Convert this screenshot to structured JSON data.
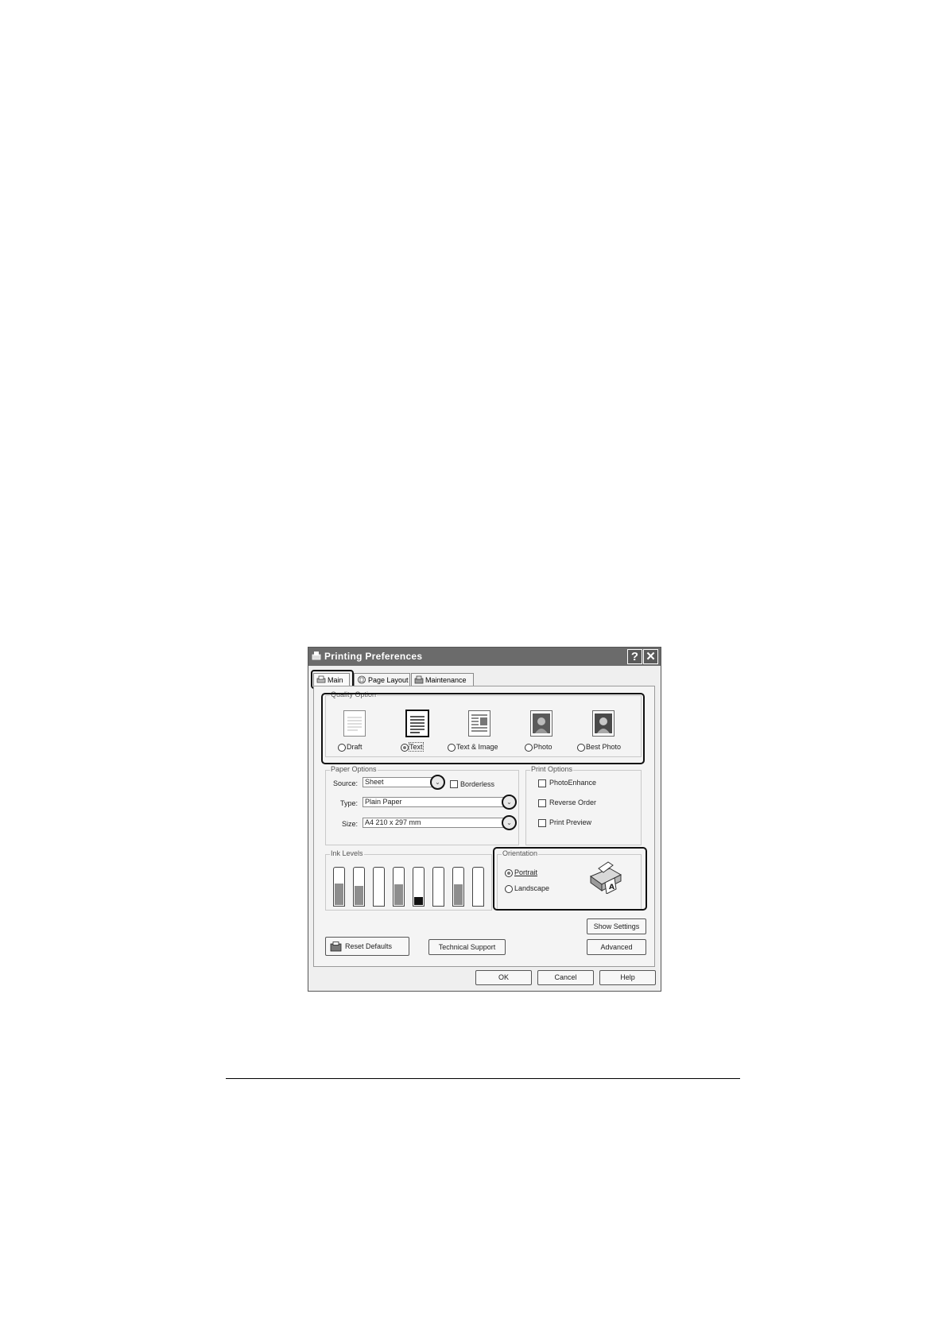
{
  "window": {
    "title": "Printing Preferences",
    "help_button": "?",
    "close_button": "✕"
  },
  "tabs": [
    {
      "label": "Main",
      "icon": "printer-icon",
      "active": true
    },
    {
      "label": "Page Layout",
      "icon": "layout-icon",
      "active": false
    },
    {
      "label": "Maintenance",
      "icon": "maintenance-icon",
      "active": false
    }
  ],
  "quality_option": {
    "label": "Quality Option",
    "options": [
      {
        "label": "Draft",
        "selected": false
      },
      {
        "label": "Text",
        "selected": true
      },
      {
        "label": "Text & Image",
        "selected": false
      },
      {
        "label": "Photo",
        "selected": false
      },
      {
        "label": "Best Photo",
        "selected": false
      }
    ]
  },
  "paper_options": {
    "label": "Paper Options",
    "source_label": "Source:",
    "source_value": "Sheet",
    "borderless_label": "Borderless",
    "type_label": "Type:",
    "type_value": "Plain Paper",
    "size_label": "Size:",
    "size_value": "A4 210 x 297 mm"
  },
  "print_options": {
    "label": "Print Options",
    "photo_enhance": "PhotoEnhance",
    "reverse_order": "Reverse Order",
    "print_preview": "Print Preview"
  },
  "ink_levels": {
    "label": "Ink Levels",
    "levels": [
      0.62,
      0.55,
      0.0,
      0.58,
      0.22,
      0.0,
      0.6,
      0.0
    ],
    "highlight_index": 4
  },
  "orientation": {
    "label": "Orientation",
    "portrait": "Portrait",
    "landscape": "Landscape",
    "selected": "Portrait"
  },
  "buttons": {
    "reset_defaults": "Reset Defaults",
    "technical_support": "Technical Support",
    "show_settings": "Show Settings",
    "advanced": "Advanced",
    "ok": "OK",
    "cancel": "Cancel",
    "help": "Help"
  }
}
